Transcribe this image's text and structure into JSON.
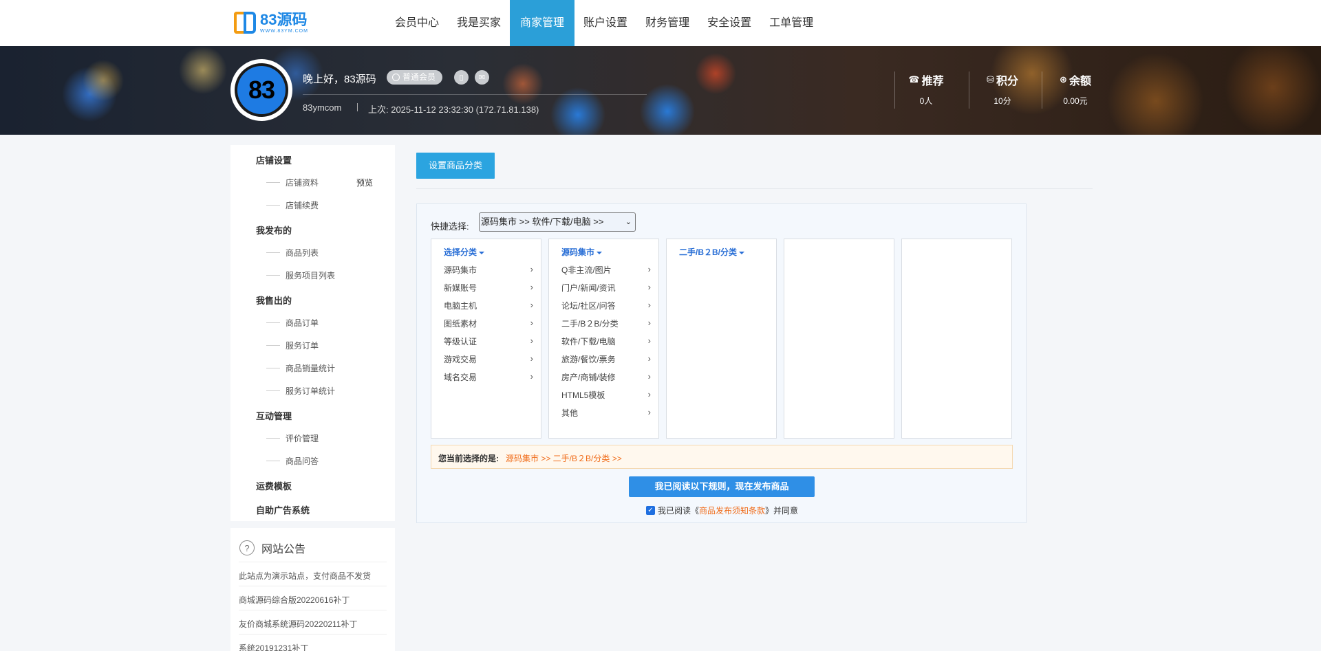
{
  "logo": {
    "main": "83源码",
    "sub": "WWW.83YM.COM"
  },
  "nav": {
    "items": [
      {
        "label": "会员中心"
      },
      {
        "label": "我是买家"
      },
      {
        "label": "商家管理"
      },
      {
        "label": "账户设置"
      },
      {
        "label": "财务管理"
      },
      {
        "label": "安全设置"
      },
      {
        "label": "工单管理"
      }
    ],
    "active": "商家管理"
  },
  "profile": {
    "avatar_text": "83",
    "greeting": "晚上好，83源码",
    "member_badge": "普通会员",
    "username": "83ymcom",
    "last_login": "上次: 2025-11-12 23:32:30 (172.71.81.138)"
  },
  "stats": [
    {
      "icon": "☎",
      "label": "推荐",
      "value": "0人"
    },
    {
      "icon": "⛁",
      "label": "积分",
      "value": "10分"
    },
    {
      "icon": "⊛",
      "label": "余额",
      "value": "0.00元"
    }
  ],
  "sidebar": {
    "groups": [
      {
        "title": "店铺设置",
        "items": [
          "店铺资料",
          "店铺续费"
        ],
        "preview": "预览"
      },
      {
        "title": "我发布的",
        "items": [
          "商品列表",
          "服务项目列表"
        ]
      },
      {
        "title": "我售出的",
        "items": [
          "商品订单",
          "服务订单",
          "商品销量统计",
          "服务订单统计"
        ]
      },
      {
        "title": "互动管理",
        "items": [
          "评价管理",
          "商品问答"
        ]
      },
      {
        "title": "运费模板",
        "items": []
      },
      {
        "title": "自助广告系统",
        "items": []
      }
    ]
  },
  "notice": {
    "title": "网站公告",
    "items": [
      "此站点为演示站点，支付商品不发货",
      "商城源码综合版20220616补丁",
      "友价商城系统源码20220211补丁",
      "系统20191231补丁"
    ]
  },
  "main": {
    "category_button": "设置商品分类",
    "quick_label": "快捷选择:",
    "quick_value": "源码集市 >> 软件/下载/电脑 >>",
    "columns": [
      {
        "head": "选择分类",
        "rows": [
          "源码集市",
          "新媒账号",
          "电脑主机",
          "图纸素材",
          "等级认证",
          "游戏交易",
          "域名交易"
        ]
      },
      {
        "head": "源码集市",
        "rows": [
          "Q非主流/图片",
          "门户/新闻/资讯",
          "论坛/社区/问答",
          "二手/B２B/分类",
          "软件/下载/电脑",
          "旅游/餐饮/票务",
          "房产/商铺/装修",
          "HTML5模板",
          "其他"
        ]
      },
      {
        "head": "二手/B２B/分类",
        "rows": []
      },
      {
        "head": "",
        "rows": []
      },
      {
        "head": "",
        "rows": []
      }
    ],
    "selected_label": "您当前选择的是:",
    "selected_value": "源码集市 >> 二手/B２B/分类 >>",
    "publish_button": "我已阅读以下规则，现在发布商品",
    "agree_prefix": "我已阅读《",
    "agree_link": "商品发布须知条款",
    "agree_suffix": "》并同意"
  }
}
